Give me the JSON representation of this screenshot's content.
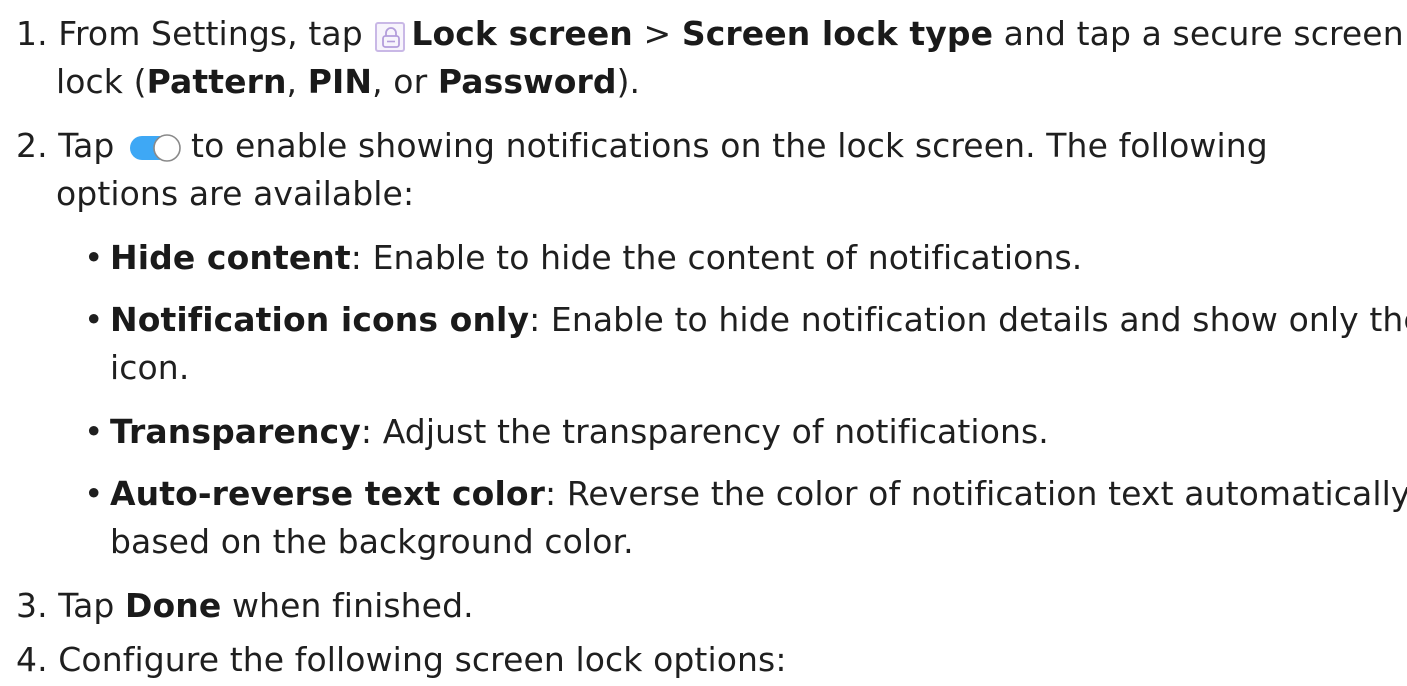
{
  "steps": [
    {
      "number": "1.",
      "pre": "From Settings, tap",
      "b1": "Lock screen",
      "sep": " > ",
      "b2": "Screen lock type",
      "post": " and tap a secure screen",
      "line2_pre": "lock (",
      "opt1": "Pattern",
      "c1": ", ",
      "opt2": "PIN",
      "c2": ", or ",
      "opt3": "Password",
      "line2_post": ")."
    },
    {
      "number": "2.",
      "pre": "Tap",
      "post": "to enable showing notifications on the lock screen. The following",
      "line2": "options are available:"
    },
    {
      "number": "3.",
      "pre": "Tap ",
      "b1": "Done",
      "post": " when finished."
    },
    {
      "number": "4.",
      "text": "Configure the following screen lock options:"
    }
  ],
  "options": [
    {
      "bullet": "•",
      "label": "Hide content",
      "desc": ": Enable to hide the content of notifications."
    },
    {
      "bullet": "•",
      "label": "Notification icons only",
      "desc": ": Enable to hide notification details and show only the",
      "desc2": "icon."
    },
    {
      "bullet": "•",
      "label": "Transparency",
      "desc": ": Adjust the transparency of notifications."
    },
    {
      "bullet": "•",
      "label": "Auto-reverse text color",
      "desc": ": Reverse the color of notification text automatically",
      "desc2": "based on the background color."
    }
  ],
  "icons": {
    "lock": "lock-icon",
    "toggle": "toggle-on-icon"
  },
  "colors": {
    "text": "#1f1f1f",
    "lock_border": "#c9b8e6",
    "toggle_track": "#3ea8f5"
  }
}
